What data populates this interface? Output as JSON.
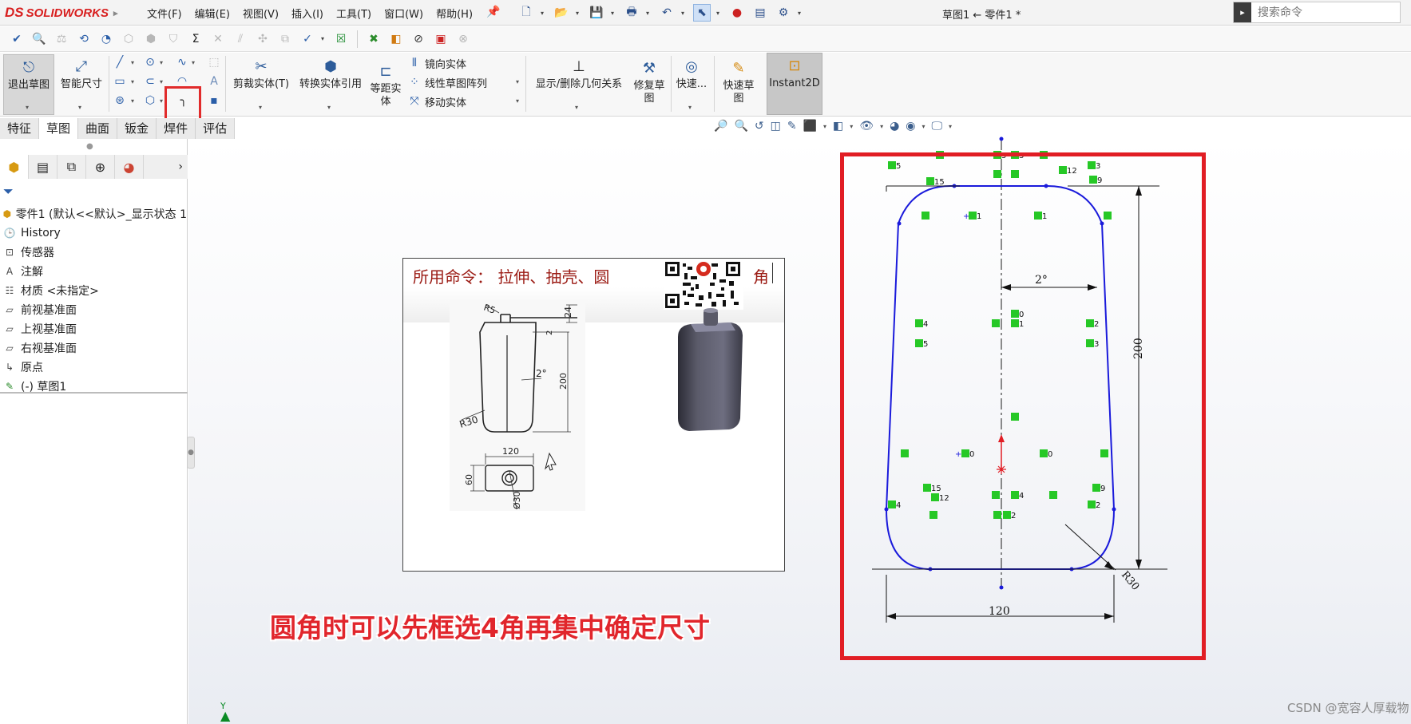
{
  "app": {
    "logo_text": "SOLIDWORKS",
    "logo_ds": "DS",
    "menus": [
      "文件(F)",
      "编辑(E)",
      "视图(V)",
      "插入(I)",
      "工具(T)",
      "窗口(W)",
      "帮助(H)"
    ],
    "doc_title": "草图1 ← 零件1 *",
    "search_placeholder": "搜索命令"
  },
  "command_manager": {
    "exit_sketch": "退出草图",
    "smart_dimension": "智能尺寸",
    "trim": "剪裁实体(T)",
    "convert": "转换实体引用",
    "offset": "等距实\n体",
    "mirror": "镜向实体",
    "linear_pattern": "线性草图阵列",
    "move": "移动实体",
    "display_relations": "显示/删除几何关系",
    "repair": "修复草\n图",
    "quick_snaps": "快速...",
    "rapid_sketch": "快速草\n图",
    "instant2d": "Instant2D"
  },
  "tabs": [
    {
      "label": "特征",
      "active": false
    },
    {
      "label": "草图",
      "active": true
    },
    {
      "label": "曲面",
      "active": false
    },
    {
      "label": "钣金",
      "active": false
    },
    {
      "label": "焊件",
      "active": false
    },
    {
      "label": "评估",
      "active": false
    }
  ],
  "tree": [
    {
      "label": "零件1  (默认<<默认>_显示状态 1",
      "icon": "part-icon"
    },
    {
      "label": "History",
      "icon": "history-icon"
    },
    {
      "label": "传感器",
      "icon": "sensor-icon"
    },
    {
      "label": "注解",
      "icon": "annotation-icon"
    },
    {
      "label": "材质 <未指定>",
      "icon": "material-icon"
    },
    {
      "label": "前视基准面",
      "icon": "plane-icon"
    },
    {
      "label": "上视基准面",
      "icon": "plane-icon"
    },
    {
      "label": "右视基准面",
      "icon": "plane-icon"
    },
    {
      "label": "原点",
      "icon": "origin-icon"
    },
    {
      "label": "(-) 草图1",
      "icon": "sketch-icon"
    }
  ],
  "reference": {
    "commands_label": "所用命令：",
    "commands": "拉伸、抽壳、圆",
    "commands_tail": "角",
    "dims": {
      "r5": "R5",
      "d24": "24",
      "d2": "2",
      "deg2": "2°",
      "d200": "200",
      "r30": "R30",
      "w120": "120",
      "h60": "60",
      "phi30": "Ø30"
    }
  },
  "tip_text": "圆角时可以先框选4角再集中确定尺寸",
  "sketch": {
    "dim_angle": "2°",
    "dim_height": "200",
    "dim_width": "120",
    "dim_radius": "R30",
    "relations": [
      "5",
      "3",
      "15",
      "12",
      "9",
      "1",
      "1",
      "0",
      "1",
      "4",
      "5",
      "2",
      "3",
      "0",
      "0",
      "15",
      "12",
      "4",
      "4",
      "2",
      "2",
      "9",
      "5",
      "3"
    ]
  },
  "watermark": "CSDN @宽容人厚载物",
  "origin_label": "Y",
  "colors": {
    "accent_red": "#e11d24",
    "sketch_blue": "#1a1adb",
    "relation_green": "#26c826"
  }
}
